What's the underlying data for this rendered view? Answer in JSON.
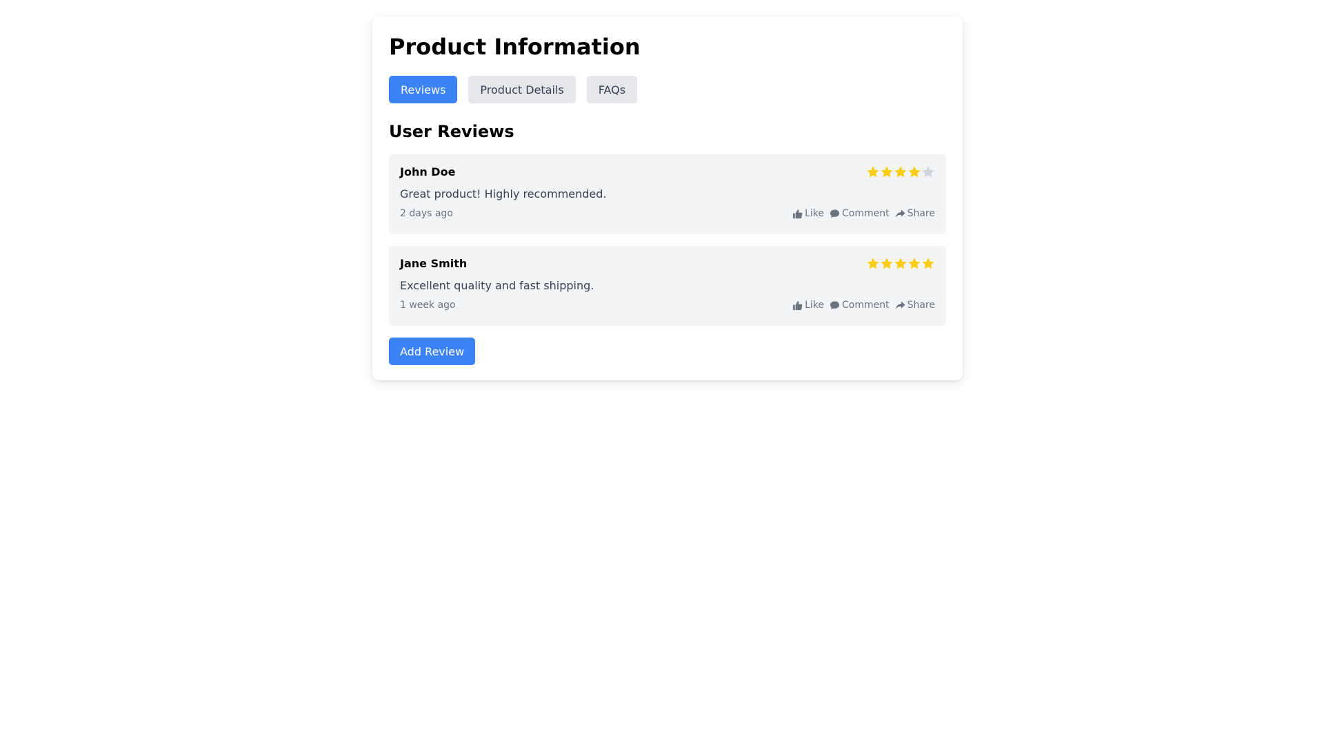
{
  "header": {
    "title": "Product Information"
  },
  "tabs": [
    {
      "label": "Reviews",
      "active": true
    },
    {
      "label": "Product Details",
      "active": false
    },
    {
      "label": "FAQs",
      "active": false
    }
  ],
  "reviews_section": {
    "title": "User Reviews",
    "reviews": [
      {
        "author": "John Doe",
        "rating": 4,
        "max_rating": 5,
        "text": "Great product! Highly recommended.",
        "time": "2 days ago",
        "actions": {
          "like": "Like",
          "comment": "Comment",
          "share": "Share"
        }
      },
      {
        "author": "Jane Smith",
        "rating": 5,
        "max_rating": 5,
        "text": "Excellent quality and fast shipping.",
        "time": "1 week ago",
        "actions": {
          "like": "Like",
          "comment": "Comment",
          "share": "Share"
        }
      }
    ],
    "add_review_label": "Add Review"
  },
  "colors": {
    "accent": "#3b82f6",
    "star_filled": "#facc15",
    "star_empty": "#d1d5db",
    "tab_inactive": "#e5e7eb",
    "review_bg": "#f3f4f6"
  },
  "icons": {
    "like": "thumbs-up-icon",
    "comment": "comment-icon",
    "share": "share-icon",
    "star": "star-icon"
  }
}
